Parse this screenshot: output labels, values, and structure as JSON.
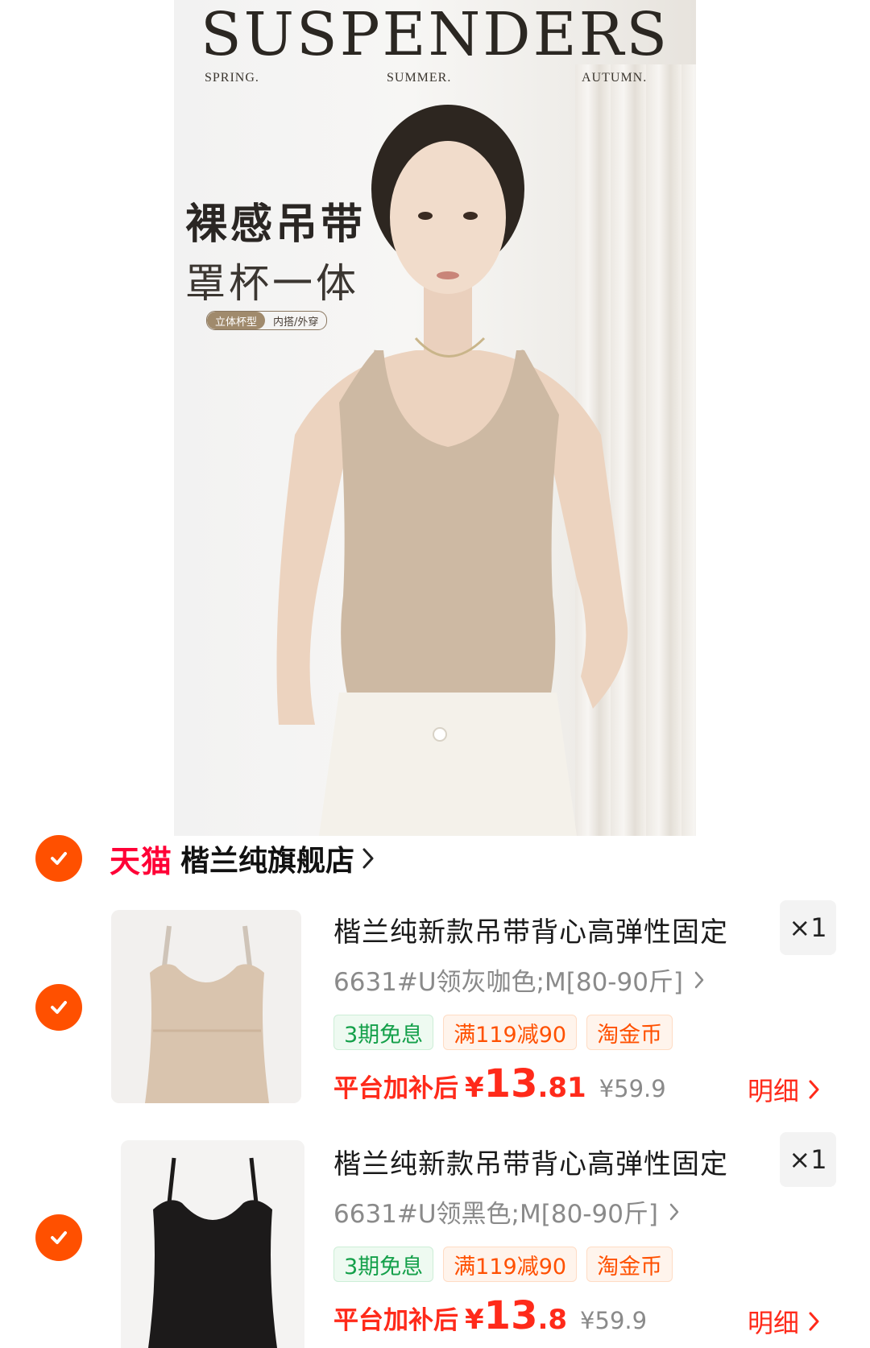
{
  "banner": {
    "brand_title": "SUSPENDERS",
    "seasons": [
      "SPRING.",
      "SUMMER.",
      "AUTUMN."
    ],
    "tagline_1": "裸感吊带",
    "tagline_2": "罩杯一体",
    "pill_left": "立体杯型",
    "pill_right": "内搭/外穿"
  },
  "store": {
    "platform": "天猫",
    "name": "楷兰纯旗舰店"
  },
  "items": [
    {
      "title": "楷兰纯新款吊带背心高弹性固定",
      "quantity": "×1",
      "sku": "6631#U领灰咖色;M[80-90斤]",
      "tags": [
        "3期免息",
        "满119减90",
        "淘金币"
      ],
      "price_label": "平台加补后",
      "price_currency": "¥",
      "price_int": "13",
      "price_dec": ".81",
      "original_price": "¥59.9",
      "detail_label": "明细",
      "color": "#d8c3ad"
    },
    {
      "title": "楷兰纯新款吊带背心高弹性固定",
      "quantity": "×1",
      "sku": "6631#U领黑色;M[80-90斤]",
      "tags": [
        "3期免息",
        "满119减90",
        "淘金币"
      ],
      "price_label": "平台加补后",
      "price_currency": "¥",
      "price_int": "13",
      "price_dec": ".8",
      "original_price": "¥59.9",
      "detail_label": "明细",
      "color": "#1c1a1a"
    }
  ],
  "colors": {
    "accent": "#ff5000",
    "tmall_red": "#ff0036",
    "price_red": "#ff2a1a"
  }
}
